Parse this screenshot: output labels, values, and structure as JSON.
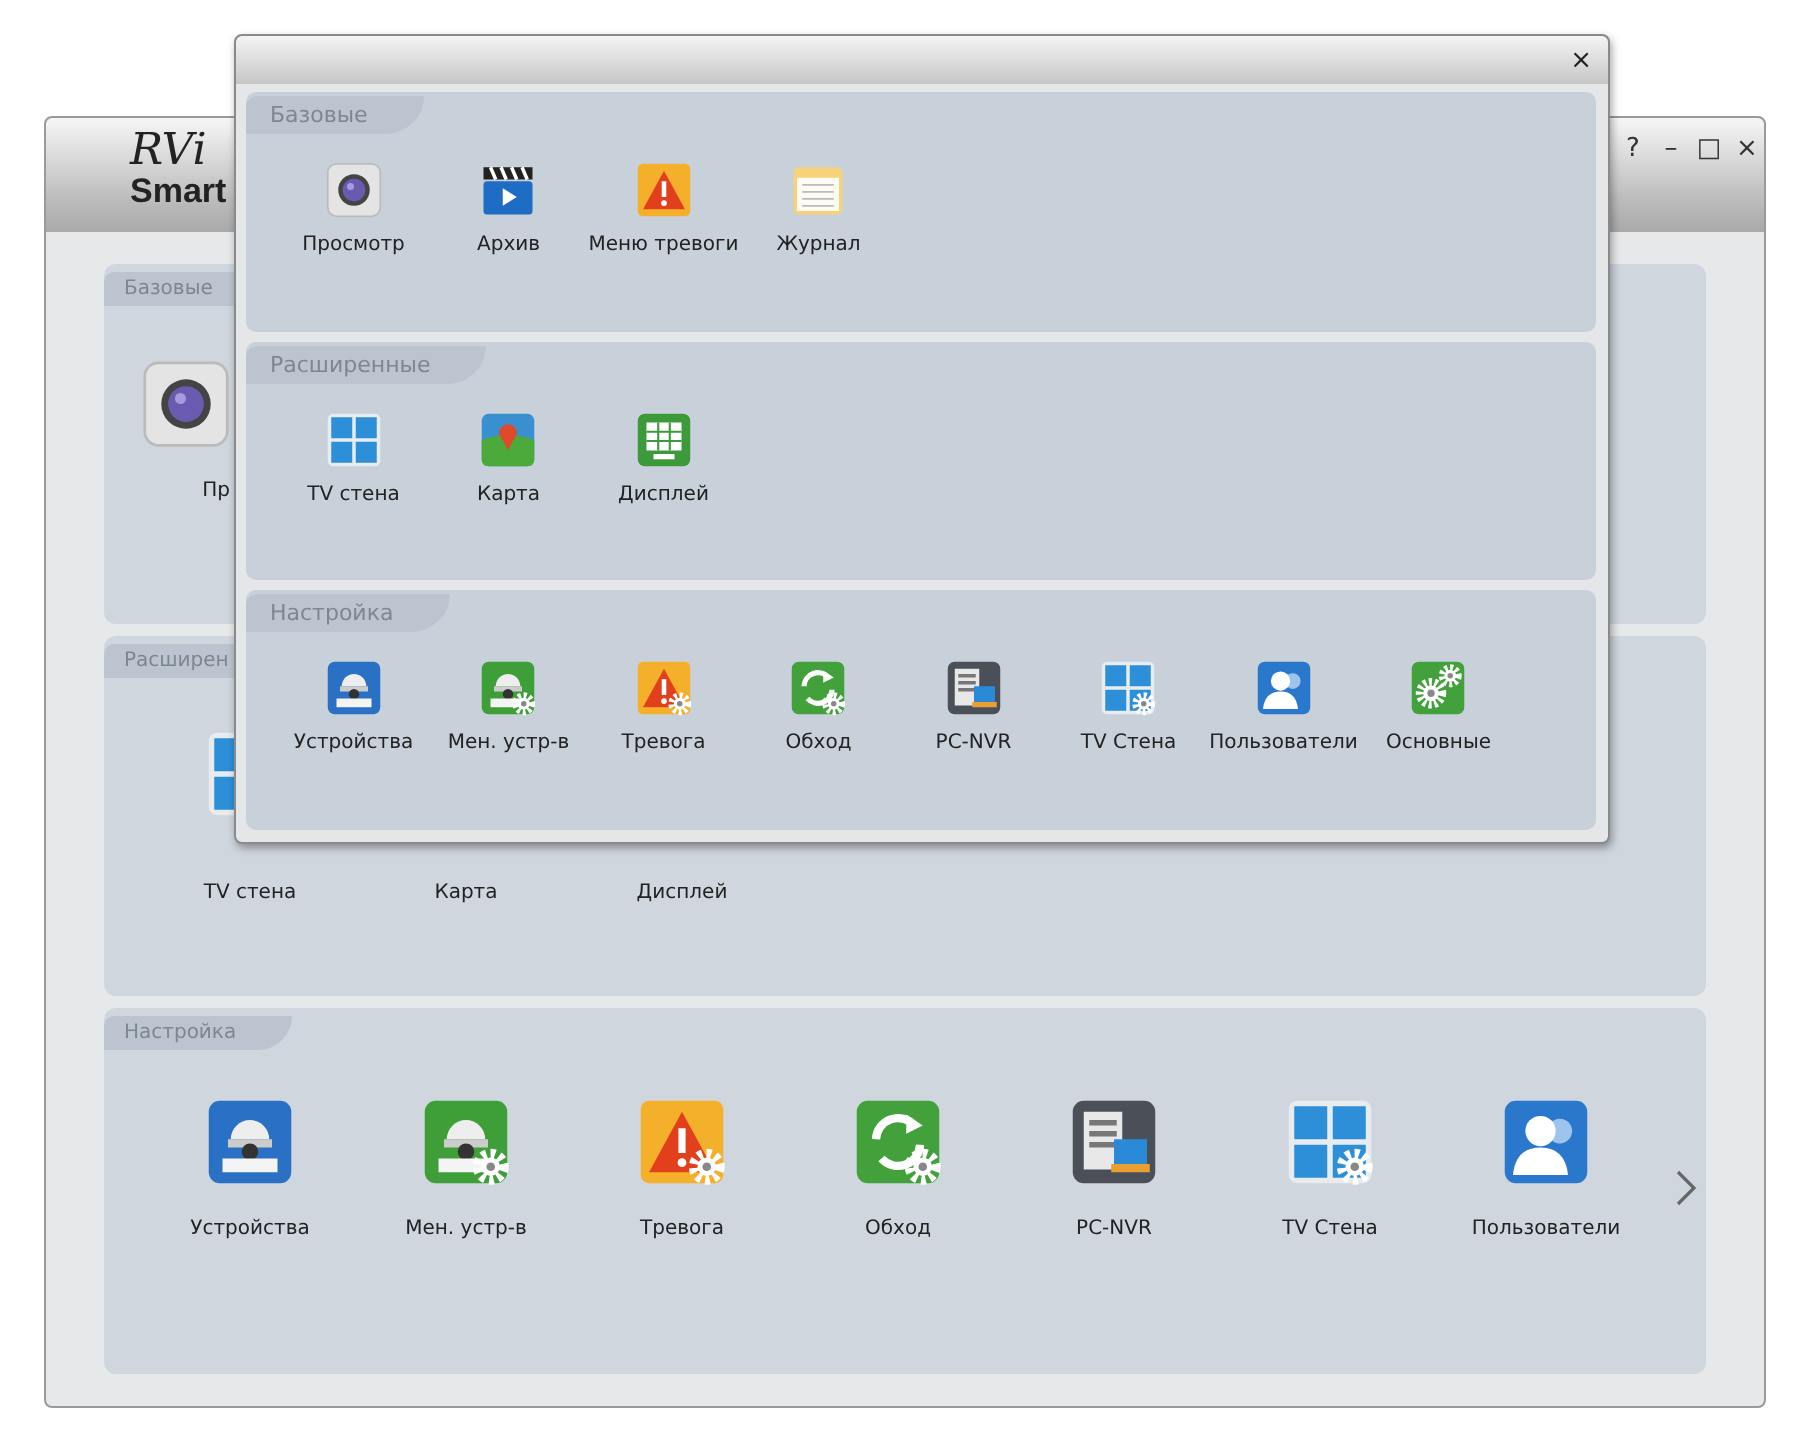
{
  "main_window": {
    "logo": {
      "script": "RVi",
      "word": "Smart"
    },
    "controls": [
      "?",
      "–",
      "□",
      "×"
    ],
    "sections": [
      {
        "title": "Базовые",
        "items": [
          {
            "label": "Пр",
            "kind": "camera"
          }
        ]
      },
      {
        "title": "Расширен",
        "items": [
          {
            "label": "TV стена",
            "kind": "tv-wall"
          },
          {
            "label": "Карта"
          },
          {
            "label": "Дисплей"
          }
        ]
      },
      {
        "title": "Настройка",
        "has_more": true,
        "items": [
          {
            "label": "Устройства",
            "kind": "device"
          },
          {
            "label": "Мен. устр-в",
            "kind": "device-gear"
          },
          {
            "label": "Тревога",
            "kind": "alarm-gear"
          },
          {
            "label": "Обход",
            "kind": "cycle-gear"
          },
          {
            "label": "PC-NVR",
            "kind": "pc-nvr"
          },
          {
            "label": "TV Стена",
            "kind": "tv-wall-gear"
          },
          {
            "label": "Пользователи",
            "kind": "users"
          }
        ]
      }
    ]
  },
  "dialog": {
    "close": "×",
    "sections": [
      {
        "title": "Базовые",
        "items": [
          {
            "label": "Просмотр",
            "kind": "camera"
          },
          {
            "label": "Архив",
            "kind": "clapper"
          },
          {
            "label": "Меню тревоги",
            "kind": "alarm"
          },
          {
            "label": "Журнал",
            "kind": "journal"
          }
        ]
      },
      {
        "title": "Расширенные",
        "items": [
          {
            "label": "TV стена",
            "kind": "tv-wall"
          },
          {
            "label": "Карта",
            "kind": "map"
          },
          {
            "label": "Дисплей",
            "kind": "display"
          }
        ]
      },
      {
        "title": "Настройка",
        "items": [
          {
            "label": "Устройства",
            "kind": "device"
          },
          {
            "label": "Мен. устр-в",
            "kind": "device-gear"
          },
          {
            "label": "Тревога",
            "kind": "alarm-gear"
          },
          {
            "label": "Обход",
            "kind": "cycle-gear"
          },
          {
            "label": "PC-NVR",
            "kind": "pc-nvr"
          },
          {
            "label": "TV Стена",
            "kind": "tv-wall-gear"
          },
          {
            "label": "Пользователи",
            "kind": "users"
          },
          {
            "label": "Основные",
            "kind": "gears"
          }
        ]
      }
    ]
  }
}
